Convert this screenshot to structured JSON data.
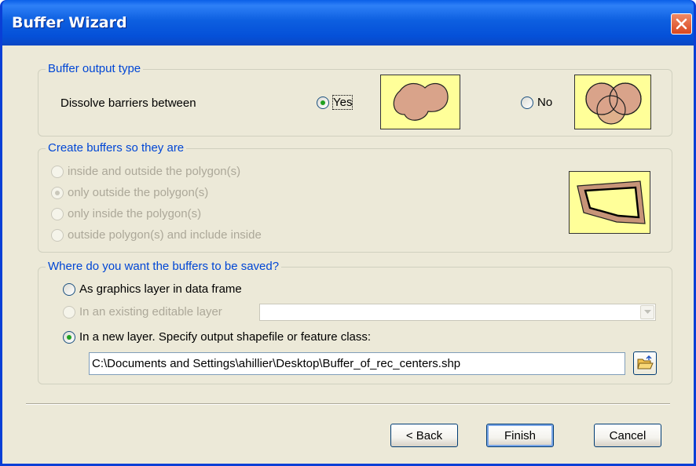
{
  "window": {
    "title": "Buffer Wizard"
  },
  "output_type": {
    "legend": "Buffer output type",
    "dissolve_label": "Dissolve barriers between",
    "yes_label": "Yes",
    "yes_checked": true,
    "no_label": "No",
    "no_checked": false
  },
  "create_buffers": {
    "legend": "Create buffers so they are",
    "options": [
      {
        "label": "inside and outside the polygon(s)",
        "checked": false
      },
      {
        "label": "only outside the polygon(s)",
        "checked": true
      },
      {
        "label": "only inside the polygon(s)",
        "checked": false
      },
      {
        "label": "outside polygon(s) and include inside",
        "checked": false
      }
    ]
  },
  "save_location": {
    "legend": "Where do you want the buffers to be saved?",
    "graphics_label": "As graphics layer in data frame",
    "existing_label": "In an existing editable layer",
    "existing_value": "",
    "new_layer_label": "In a new layer.  Specify output shapefile or feature class:",
    "path": "C:\\Documents and Settings\\ahillier\\Desktop\\Buffer_of_rec_centers.shp"
  },
  "buttons": {
    "back": "< Back",
    "finish": "Finish",
    "cancel": "Cancel"
  },
  "colors": {
    "title_bar": "#0a5fe8",
    "accent": "#0046d5",
    "preview_fill": "#ffff99",
    "buffer_fill": "#d9a38a"
  }
}
